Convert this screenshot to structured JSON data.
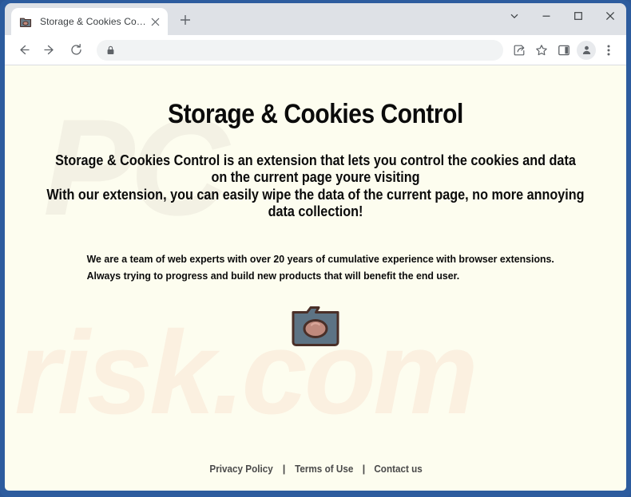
{
  "browser": {
    "tab": {
      "title": "Storage & Cookies Control",
      "favicon_icon": "folder-cloud-icon",
      "close_icon": "close-icon"
    },
    "new_tab_icon": "plus-icon",
    "window_controls": [
      {
        "name": "minimize-group-icon",
        "glyph": "chevron-down-icon"
      },
      {
        "name": "minimize-icon",
        "glyph": "minimize-icon"
      },
      {
        "name": "maximize-icon",
        "glyph": "maximize-icon"
      },
      {
        "name": "close-window-icon",
        "glyph": "close-icon"
      }
    ],
    "toolbar": {
      "back_icon": "back-arrow-icon",
      "forward_icon": "forward-arrow-icon",
      "reload_icon": "reload-icon",
      "omnibox": {
        "value": "",
        "placeholder": "",
        "lock_icon": "lock-icon"
      },
      "share_icon": "share-icon",
      "bookmark_icon": "star-icon",
      "sidepanel_icon": "side-panel-icon",
      "profile_icon": "profile-avatar-icon",
      "menu_icon": "three-dot-menu-icon"
    }
  },
  "page": {
    "title": "Storage & Cookies Control",
    "intro_line1": "Storage & Cookies Control is an extension that lets you control the cookies and data on the current page youre visiting",
    "intro_line2": "With our extension, you can easily wipe the data of the current page, no more annoying data collection!",
    "team_line1": "We are a team of web experts with over 20 years of cumulative experience with browser extensions.",
    "team_line2": "Always trying to progress and build new products that will benefit the end user.",
    "hero_icon": "folder-cloud-icon",
    "watermark_top": "PC",
    "watermark_bottom": "risk.com",
    "footer": {
      "privacy_label": "Privacy Policy",
      "separator": "|",
      "terms_label": "Terms of Use",
      "contact_label": "Contact us"
    },
    "colors": {
      "background": "#fdfdef",
      "text": "#0b0b0b",
      "footer_link": "#4a4a4a",
      "folder_body": "#5d7384",
      "folder_border": "#4a2f28",
      "cloud": "#c08a7d",
      "window_frame": "#2d5c9e"
    }
  }
}
